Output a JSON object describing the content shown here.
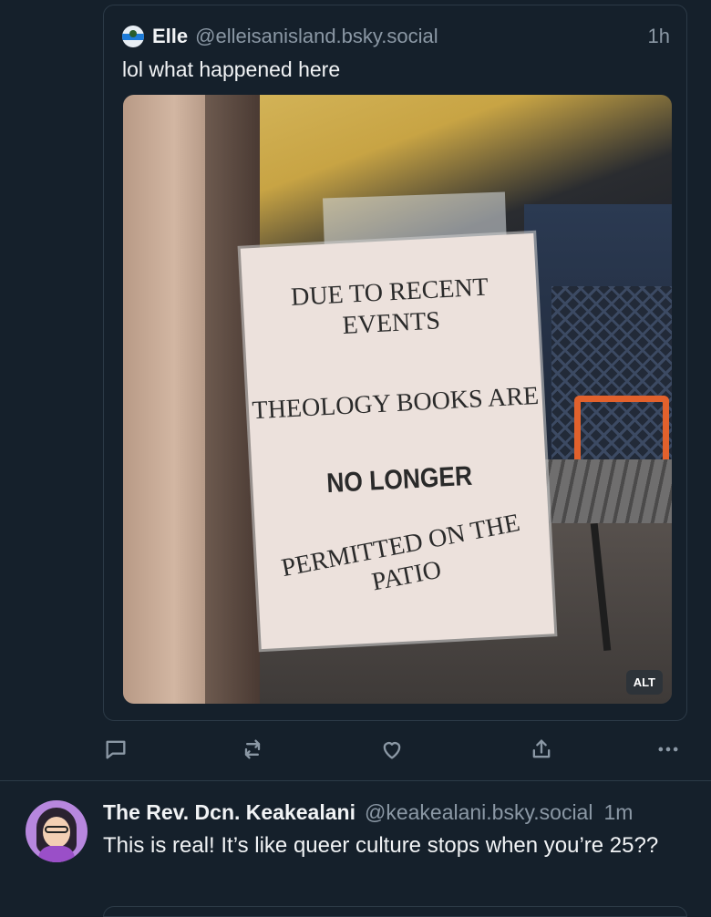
{
  "quoted_post": {
    "author_name": "Elle",
    "author_handle": "@elleisanisland.bsky.social",
    "time": "1h",
    "text": "lol what happened here",
    "image": {
      "sign_line_1": "DUE TO RECENT EVENTS",
      "sign_line_2": "THEOLOGY BOOKS ARE",
      "sign_line_3": "NO LONGER",
      "sign_line_4": "PERMITTED ON THE PATIO",
      "alt_badge": "ALT"
    }
  },
  "actions": {
    "icons": [
      "reply-icon",
      "repost-icon",
      "like-icon",
      "share-icon",
      "more-icon"
    ]
  },
  "reply": {
    "author_name": "The Rev. Dcn. Keakealani",
    "author_handle": "@keakealani.bsky.social",
    "time": "1m",
    "text": "This is real! It’s like queer culture stops when you’re 25??"
  },
  "colors": {
    "background": "#15202b",
    "border": "#2c3a47",
    "muted": "#8b98a5",
    "text": "#f1f3f5"
  }
}
